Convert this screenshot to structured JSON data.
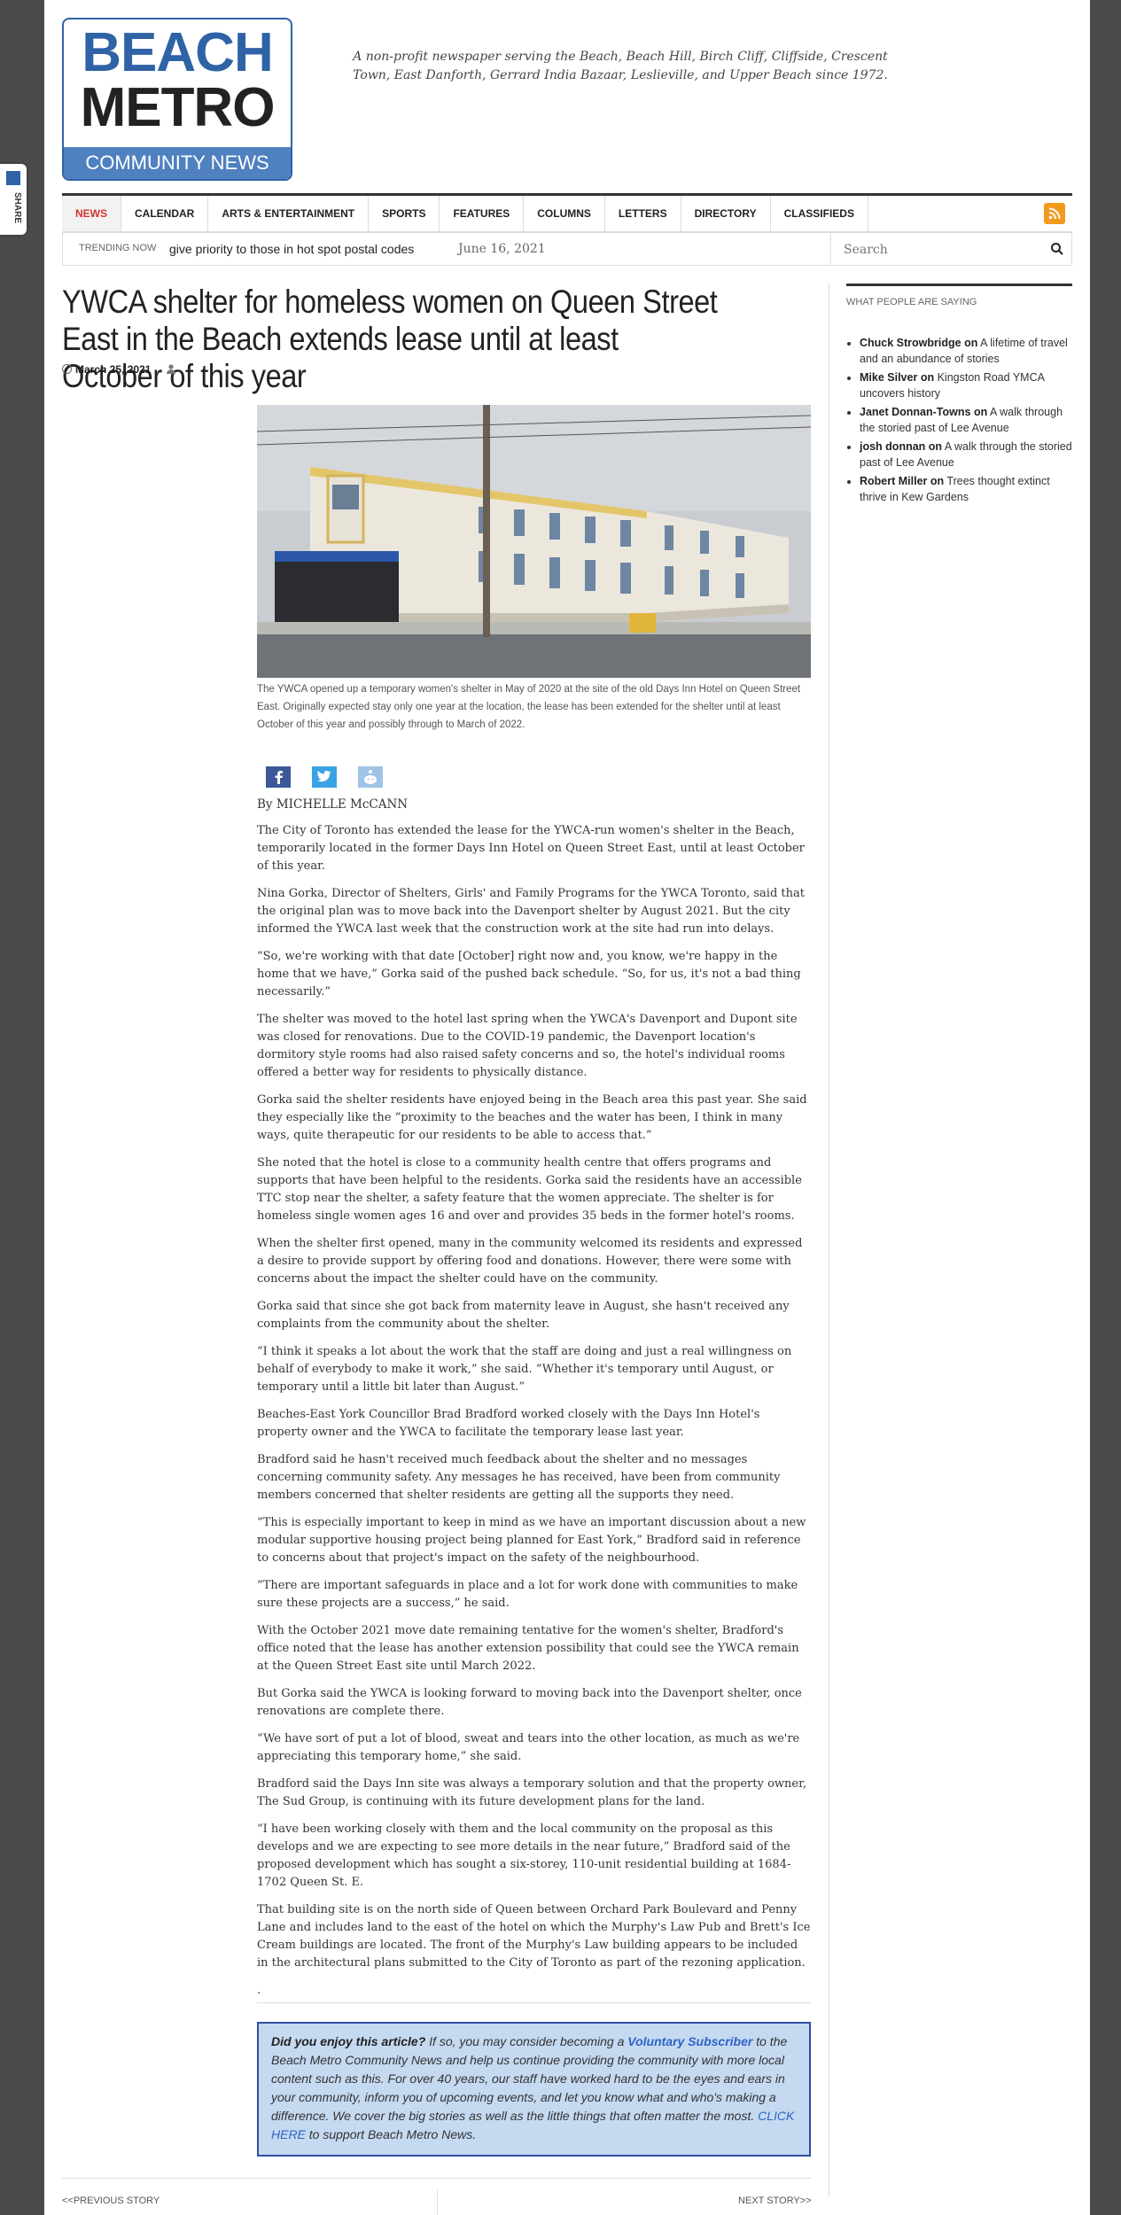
{
  "share": {
    "label": "SHARE"
  },
  "logo": {
    "line1": "BEACH",
    "line2": "METRO",
    "line3": "COMMUNITY NEWS"
  },
  "tagline": "A non-profit newspaper serving the Beach, Beach Hill, Birch Cliff, Cliffside, Crescent Town, East Danforth, Gerrard India Bazaar, Leslieville, and Upper Beach since 1972.",
  "nav": {
    "items": [
      "NEWS",
      "CALENDAR",
      "ARTS & ENTERTAINMENT",
      "SPORTS",
      "FEATURES",
      "COLUMNS",
      "LETTERS",
      "DIRECTORY",
      "CLASSIFIEDS"
    ],
    "active_index": 0
  },
  "trending": {
    "label": "TRENDING NOW",
    "headline": "give priority to those in hot spot postal codes",
    "date": "June 16, 2021"
  },
  "search": {
    "placeholder": "Search"
  },
  "article": {
    "title": "YWCA shelter for homeless women on Queen Street East in the Beach extends lease until at least October of this year",
    "date": "March 25, 2021",
    "caption": "The YWCA opened up a temporary women's shelter in May of 2020 at the site of the old Days Inn Hotel on Queen Street East. Originally expected stay only one year at the location, the lease has been extended for the shelter until at least October of this year and possibly through to March of 2022.",
    "byline": "By MICHELLE McCANN",
    "paragraphs": [
      "The City of Toronto has extended the lease for the YWCA-run women's shelter in the Beach, temporarily located in the former Days Inn Hotel on Queen Street East, until at least October of this year.",
      "Nina Gorka, Director of Shelters, Girls' and Family Programs for the YWCA Toronto, said that the original plan was to move back into the Davenport shelter by August 2021. But the city informed the YWCA last week that the construction work at the site had run into delays.",
      "“So, we're working with that date [October] right now and, you know, we're happy in the home that we have,” Gorka said of the pushed back schedule. “So, for us, it's not a bad thing necessarily.”",
      "The shelter was moved to the hotel last spring when the YWCA's Davenport and Dupont site was closed for renovations. Due to the COVID-19 pandemic, the Davenport location's dormitory style rooms had also raised safety concerns and so, the hotel's individual rooms offered a better way for residents to physically distance.",
      "Gorka said the shelter residents have enjoyed being in the Beach area this past year. She said they especially like the “proximity to the beaches and the water has been, I think in many ways, quite therapeutic for our residents to be able to access that.”",
      "She noted that the hotel is close to a community health centre that offers programs and supports that have been helpful to the residents. Gorka said the residents have an accessible TTC stop near the shelter, a safety feature that the women appreciate. The shelter is for homeless single women ages 16 and over and provides 35 beds in the former hotel's rooms.",
      "When the shelter first opened, many in the community welcomed its residents and expressed a desire to provide support by offering food and donations. However, there were some with concerns about the impact the shelter could have on the community.",
      "Gorka said that since she got back from maternity leave in August, she hasn't received any complaints from the community about the shelter.",
      "“I think it speaks a lot about the work that the staff are doing and just a real willingness on behalf of everybody to make it work,” she said. “Whether it's temporary until August, or temporary until a little bit later than August.”",
      "Beaches-East York Councillor Brad Bradford worked closely with the Days Inn Hotel's property owner and the YWCA to facilitate the temporary lease last year.",
      "Bradford said he hasn't received much feedback about the shelter and no messages concerning community safety. Any messages he has received, have been from community members concerned that shelter residents are getting all the supports they need.",
      "“This is especially important to keep in mind as we have an important discussion about a new modular supportive housing project being planned for East York,” Bradford said in reference to concerns about that project's impact on the safety of the neighbourhood.",
      "“There are important safeguards in place and a lot for work done with communities to make sure these projects are a success,” he said.",
      "With the October 2021 move date remaining tentative for the women's shelter, Bradford's office noted that the lease has another extension possibility that could see the YWCA remain at the Queen Street East site until March 2022.",
      "But Gorka said the YWCA is looking forward to moving back into the Davenport shelter, once renovations are complete there.",
      "“We have sort of put a lot of blood, sweat and tears into the other location, as much as we're appreciating this temporary home,” she said.",
      "Bradford said the Days Inn site was always a temporary solution and that the property owner, The Sud Group, is continuing with its future development plans for the land.",
      "“I have been working closely with them and the local community on the proposal as this develops and we are expecting to see more details in the near future,” Bradford said of the proposed development which has sought a six-storey, 110-unit residential building at 1684-1702 Queen St. E.",
      "That building site is on the north side of Queen between Orchard Park Boulevard and Penny Lane and includes land to the east of the hotel on which the Murphy's Law Pub and Brett's Ice Cream buildings are located. The front of the Murphy's Law building appears to be included in the architectural plans submitted to the City of Toronto as part of the rezoning application.",
      "."
    ]
  },
  "support": {
    "lead": "Did you enjoy this article?",
    "text1": " If so, you may consider becoming a ",
    "link1": "Voluntary Subscriber",
    "text2": " to the Beach Metro Community News and help us continue providing the community with more local content such as this. For over 40 years, our staff have worked hard to be the eyes and ears in your community, inform you of upcoming events, and let you know what and who's making a difference. We cover the big stories as well as the little things that often matter the most. ",
    "link2": "CLICK HERE",
    "text3": " to support Beach Metro News."
  },
  "pager": {
    "prev": "<<PREVIOUS STORY",
    "next": "NEXT STORY>>"
  },
  "sidebar": {
    "heading": "WHAT PEOPLE ARE SAYING",
    "comments": [
      {
        "author": "Chuck Strowbridge",
        "on": "on",
        "title": "A lifetime of travel and an abundance of stories"
      },
      {
        "author": "Mike Silver",
        "on": "on",
        "title": "Kingston Road YMCA uncovers history"
      },
      {
        "author": "Janet Donnan-Towns",
        "on": "on",
        "title": "A walk through the storied past of Lee Avenue"
      },
      {
        "author": "josh donnan",
        "on": "on",
        "title": "A walk through the storied past of Lee Avenue"
      },
      {
        "author": "Robert Miller",
        "on": "on",
        "title": "Trees thought extinct thrive in Kew Gardens"
      }
    ]
  },
  "colors": {
    "brand_blue": "#2f63a6",
    "nav_active": "#d0342c",
    "rss": "#f39a1d",
    "support_bg": "#c5d9f1"
  },
  "icons": [
    "share-logo-icon",
    "rss-icon",
    "search-icon",
    "clock-icon",
    "user-icon",
    "facebook-icon",
    "twitter-icon",
    "reddit-icon"
  ]
}
